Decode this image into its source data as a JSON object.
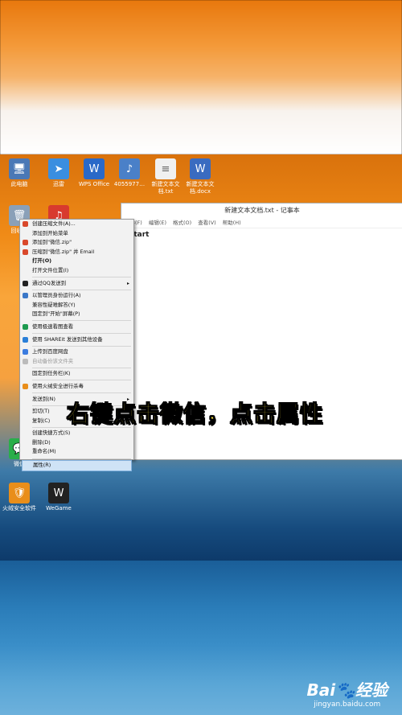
{
  "desktop": {
    "icons": [
      {
        "label": "此电脑",
        "color": "#4a78b6",
        "glyph": "🖥"
      },
      {
        "label": "迅雷",
        "color": "#3a8ee0",
        "glyph": "➤"
      },
      {
        "label": "WPS Office",
        "color": "#2a69c8",
        "glyph": "W"
      },
      {
        "label": "4055977…",
        "color": "#4a80c8",
        "glyph": "♪"
      },
      {
        "label": "新建文本文档.txt",
        "color": "#f0f0f0",
        "glyph": "≡"
      },
      {
        "label": "新建文本文档.docx",
        "color": "#3a6bc0",
        "glyph": "W"
      },
      {
        "label": "回收站",
        "color": "#8aa0b8",
        "glyph": "🗑"
      },
      {
        "label": "网易云音乐",
        "color": "#d83a2e",
        "glyph": "♫"
      },
      {
        "label": "微信",
        "color": "#2aae4a",
        "glyph": "💬"
      },
      {
        "label": "WeGame",
        "color": "#222222",
        "glyph": "W"
      },
      {
        "label": "火绒安全软件",
        "color": "#e98e1a",
        "glyph": "🛡"
      },
      {
        "label": "WeGame",
        "color": "#222222",
        "glyph": "W"
      }
    ]
  },
  "notepad": {
    "title": "新建文本文档.txt - 记事本",
    "menu": [
      "文件(F)",
      "编辑(E)",
      "格式(O)",
      "查看(V)",
      "帮助(H)"
    ],
    "content": "start"
  },
  "context_menu": {
    "items": [
      {
        "label": "创建压缩文件(A)...",
        "icon": "#d9482b"
      },
      {
        "label": "添加到开始菜单",
        "icon": ""
      },
      {
        "label": "添加到\"微信.zip\"",
        "icon": "#d9482b"
      },
      {
        "label": "压缩到\"微信.zip\" 并 Email",
        "icon": "#d9482b"
      },
      {
        "label": "打开(O)",
        "icon": "",
        "bold": true
      },
      {
        "label": "打开文件位置(I)",
        "icon": ""
      },
      {
        "sep": true
      },
      {
        "label": "通过QQ发送到",
        "icon": "#222",
        "arrow": true
      },
      {
        "sep": true
      },
      {
        "label": "以管理员身份运行(A)",
        "icon": "#3b78c8"
      },
      {
        "label": "兼容性疑难解答(Y)",
        "icon": ""
      },
      {
        "label": "固定到\"开始\"屏幕(P)",
        "icon": ""
      },
      {
        "sep": true
      },
      {
        "label": "使用极速看图查看",
        "icon": "#1d9a4f"
      },
      {
        "sep": true
      },
      {
        "label": "使用 SHAREit 发送到其他设备",
        "icon": "#2a7fd8"
      },
      {
        "sep": true
      },
      {
        "label": "上传到百度网盘",
        "icon": "#3b7ce0"
      },
      {
        "label": "自动备份该文件夹",
        "icon": "#bbb",
        "disabled": true
      },
      {
        "sep": true
      },
      {
        "label": "固定到任务栏(K)",
        "icon": ""
      },
      {
        "sep": true
      },
      {
        "label": "使用火绒安全进行杀毒",
        "icon": "#e98e1a"
      },
      {
        "sep": true
      },
      {
        "label": "发送到(N)",
        "icon": "",
        "arrow": true
      },
      {
        "sep": true
      },
      {
        "label": "剪切(T)",
        "icon": ""
      },
      {
        "label": "复制(C)",
        "icon": ""
      },
      {
        "sep": true
      },
      {
        "label": "创建快捷方式(S)",
        "icon": ""
      },
      {
        "label": "删除(D)",
        "icon": ""
      },
      {
        "label": "重命名(M)",
        "icon": ""
      },
      {
        "sep": true
      },
      {
        "label": "属性(R)",
        "icon": "",
        "highlight": true
      }
    ]
  },
  "caption": "右键点击微信，点击属性",
  "watermark": {
    "logo": "Bai🐾经验",
    "url": "jingyan.baidu.com"
  }
}
